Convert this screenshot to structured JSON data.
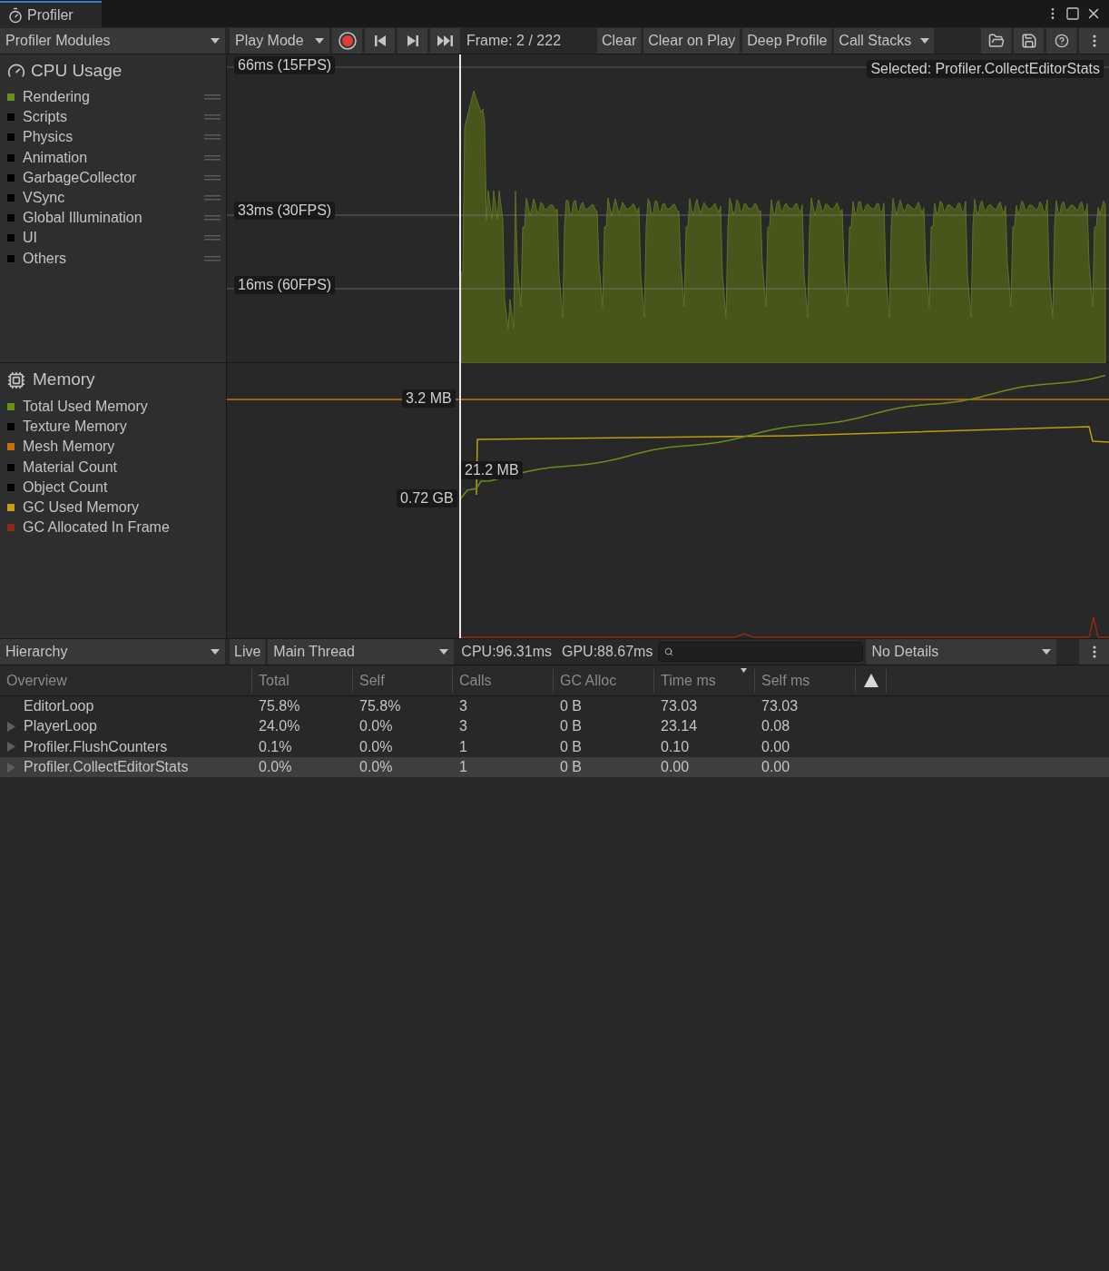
{
  "window": {
    "title": "Profiler"
  },
  "toolbar": {
    "modules": "Profiler Modules",
    "target": "Play Mode",
    "record": {
      "on": true
    },
    "frame": "Frame: 2 / 222",
    "buttons": [
      "Clear",
      "Clear on Play",
      "Deep Profile"
    ],
    "call_stacks": "Call Stacks"
  },
  "cpu_module": {
    "title": "CPU Usage",
    "items": [
      {
        "label": "Rendering",
        "color": "#6a8f1a"
      },
      {
        "label": "Scripts",
        "color": "#000000"
      },
      {
        "label": "Physics",
        "color": "#000000"
      },
      {
        "label": "Animation",
        "color": "#000000"
      },
      {
        "label": "GarbageCollector",
        "color": "#000000"
      },
      {
        "label": "VSync",
        "color": "#000000"
      },
      {
        "label": "Global Illumination",
        "color": "#000000"
      },
      {
        "label": "UI",
        "color": "#000000"
      },
      {
        "label": "Others",
        "color": "#000000"
      }
    ],
    "gridlines": [
      "66ms (15FPS)",
      "33ms (30FPS)",
      "16ms (60FPS)"
    ],
    "selected": "Selected: Profiler.CollectEditorStats"
  },
  "memory_module": {
    "title": "Memory",
    "items": [
      {
        "label": "Total Used Memory",
        "color": "#6a8f1a"
      },
      {
        "label": "Texture Memory",
        "color": "#000000"
      },
      {
        "label": "Mesh Memory",
        "color": "#c8700e"
      },
      {
        "label": "Material Count",
        "color": "#000000"
      },
      {
        "label": "Object Count",
        "color": "#000000"
      },
      {
        "label": "GC Used Memory",
        "color": "#c8a010"
      },
      {
        "label": "GC Allocated In Frame",
        "color": "#8a2a10"
      }
    ],
    "values": [
      "3.2 MB",
      "21.2 MB",
      "0.72 GB"
    ]
  },
  "details_bar": {
    "view": "Hierarchy",
    "live": "Live",
    "thread": "Main Thread",
    "cpu": "CPU:96.31ms",
    "gpu": "GPU:88.67ms",
    "details": "No Details"
  },
  "table": {
    "columns": [
      {
        "label": "Overview",
        "sorted": false
      },
      {
        "label": "Total",
        "sorted": false
      },
      {
        "label": "Self",
        "sorted": false
      },
      {
        "label": "Calls",
        "sorted": false
      },
      {
        "label": "GC Alloc",
        "sorted": false
      },
      {
        "label": "Time ms",
        "sorted": true
      },
      {
        "label": "Self ms",
        "sorted": false
      }
    ],
    "rows": [
      {
        "cells": [
          "EditorLoop",
          "75.8%",
          "75.8%",
          "3",
          "0 B",
          "73.03",
          "73.03"
        ],
        "has_children": false,
        "selected": false
      },
      {
        "cells": [
          "PlayerLoop",
          "24.0%",
          "0.0%",
          "3",
          "0 B",
          "23.14",
          "0.08"
        ],
        "has_children": true,
        "selected": false
      },
      {
        "cells": [
          "Profiler.FlushCounters",
          "0.1%",
          "0.0%",
          "1",
          "0 B",
          "0.10",
          "0.00"
        ],
        "has_children": true,
        "selected": false
      },
      {
        "cells": [
          "Profiler.CollectEditorStats",
          "0.0%",
          "0.0%",
          "1",
          "0 B",
          "0.00",
          "0.00"
        ],
        "has_children": true,
        "selected": true
      }
    ]
  }
}
